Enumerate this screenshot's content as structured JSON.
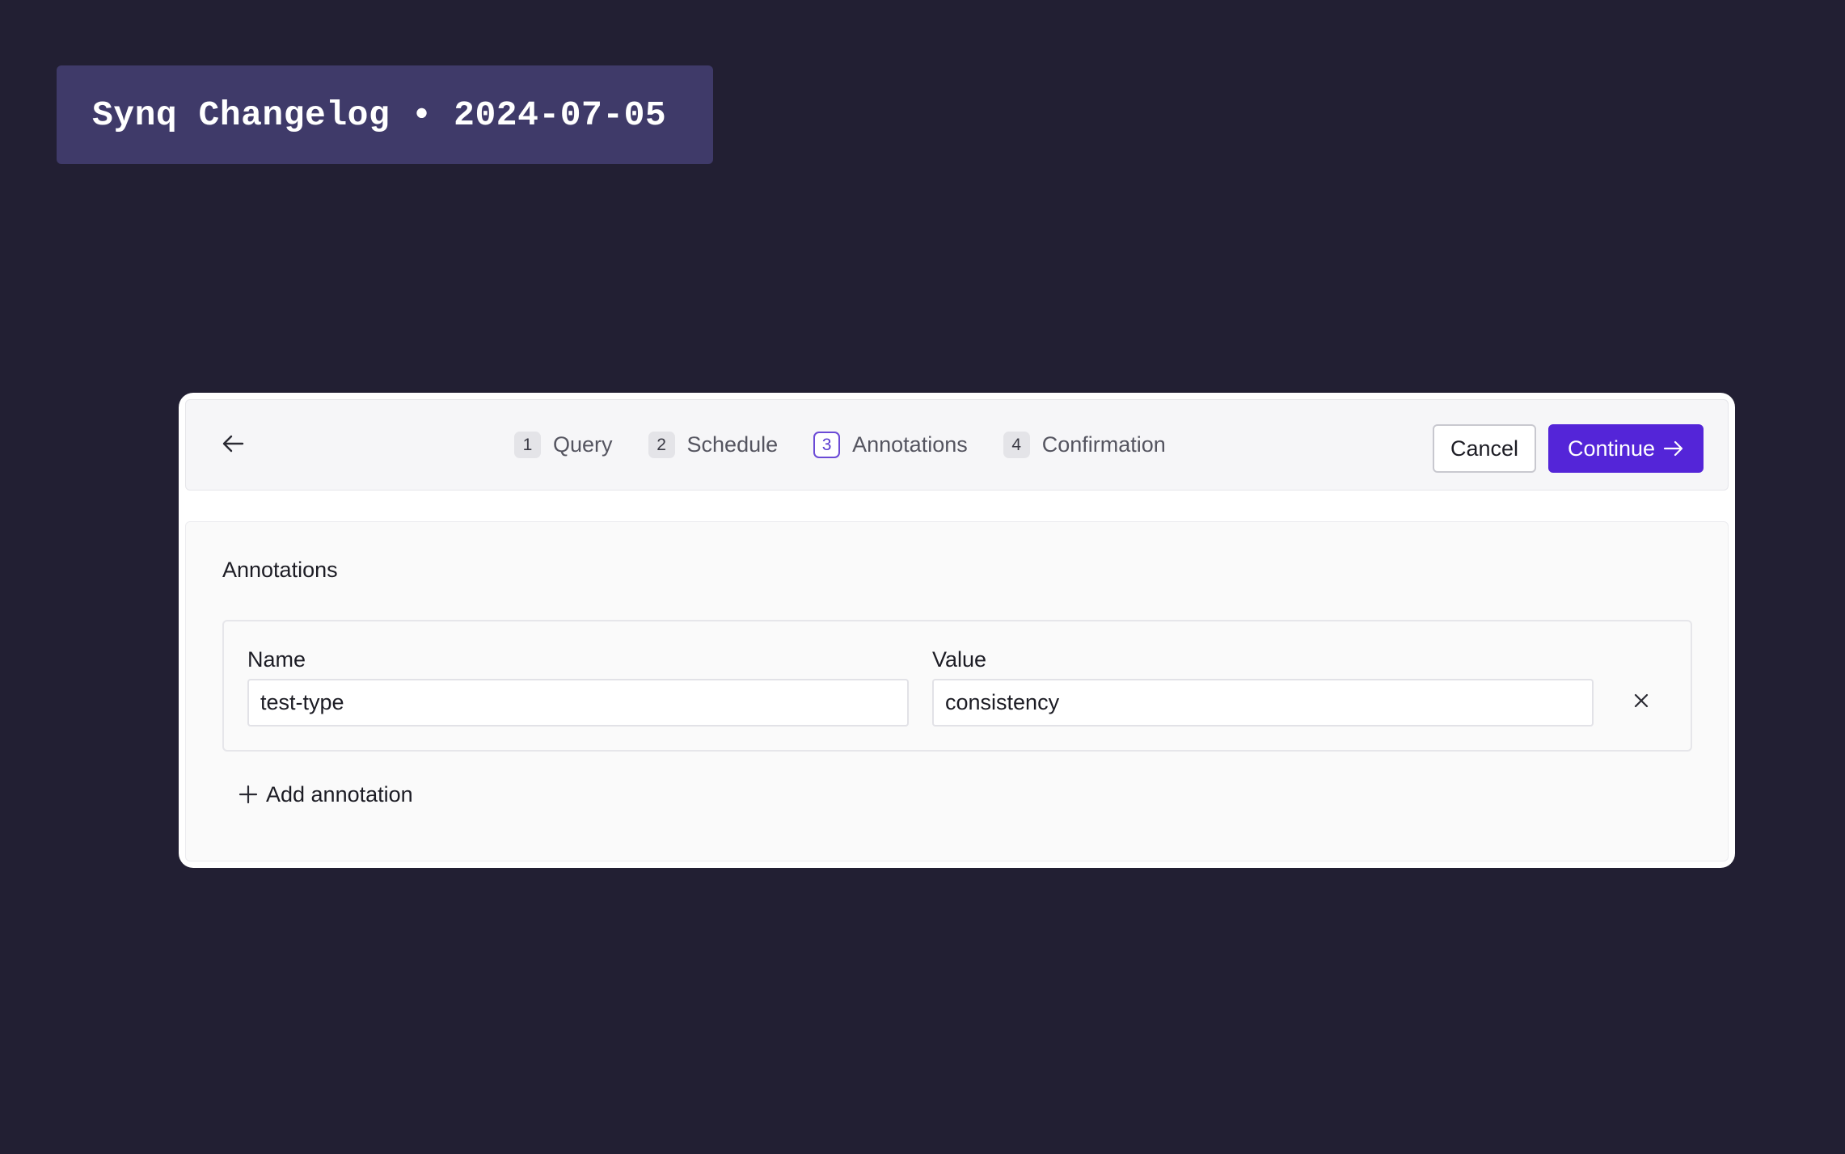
{
  "banner": {
    "text": "Synq Changelog • 2024-07-05"
  },
  "wizard": {
    "steps": [
      {
        "number": "1",
        "label": "Query",
        "active": false
      },
      {
        "number": "2",
        "label": "Schedule",
        "active": false
      },
      {
        "number": "3",
        "label": "Annotations",
        "active": true
      },
      {
        "number": "4",
        "label": "Confirmation",
        "active": false
      }
    ],
    "cancel_label": "Cancel",
    "continue_label": "Continue",
    "back_icon": "arrow-left-icon",
    "continue_icon": "arrow-right-icon"
  },
  "annotations": {
    "title": "Annotations",
    "name_label": "Name",
    "value_label": "Value",
    "rows": [
      {
        "name": "test-type",
        "value": "consistency"
      }
    ],
    "remove_icon": "close-icon",
    "add_label": "Add annotation",
    "add_icon": "plus-icon"
  },
  "colors": {
    "background": "#221f33",
    "banner": "#3f3a69",
    "accent": "#5425d8"
  }
}
